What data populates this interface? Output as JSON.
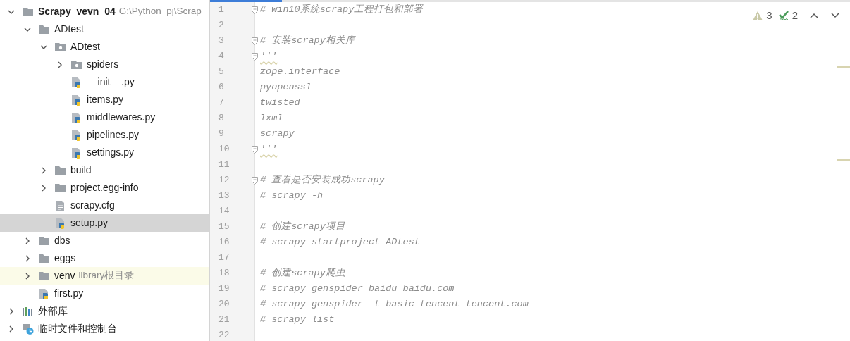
{
  "project_tree": [
    {
      "label": "Scrapy_vevn_04",
      "hint": "G:\\Python_pj\\Scrap",
      "bold": true,
      "kind": "folder",
      "expanded": true,
      "selected": false,
      "highlighted": false,
      "children": [
        {
          "label": "ADtest",
          "kind": "folder",
          "expanded": true,
          "selected": false,
          "highlighted": false,
          "children": [
            {
              "label": "ADtest",
              "kind": "package",
              "expanded": true,
              "selected": false,
              "highlighted": false,
              "children": [
                {
                  "label": "spiders",
                  "kind": "package",
                  "expanded": false,
                  "selected": false,
                  "highlighted": false
                },
                {
                  "label": "__init__.py",
                  "kind": "python",
                  "selected": false,
                  "highlighted": false
                },
                {
                  "label": "items.py",
                  "kind": "python",
                  "selected": false,
                  "highlighted": false
                },
                {
                  "label": "middlewares.py",
                  "kind": "python",
                  "selected": false,
                  "highlighted": false
                },
                {
                  "label": "pipelines.py",
                  "kind": "python",
                  "selected": false,
                  "highlighted": false
                },
                {
                  "label": "settings.py",
                  "kind": "python",
                  "selected": false,
                  "highlighted": false
                }
              ]
            },
            {
              "label": "build",
              "kind": "folder",
              "expanded": false,
              "selected": false,
              "highlighted": false
            },
            {
              "label": "project.egg-info",
              "kind": "folder",
              "expanded": false,
              "selected": false,
              "highlighted": false
            },
            {
              "label": "scrapy.cfg",
              "kind": "text",
              "selected": false,
              "highlighted": false
            },
            {
              "label": "setup.py",
              "kind": "python",
              "selected": true,
              "highlighted": false
            }
          ]
        },
        {
          "label": "dbs",
          "kind": "folder",
          "expanded": false,
          "selected": false,
          "highlighted": false
        },
        {
          "label": "eggs",
          "kind": "folder",
          "expanded": false,
          "selected": false,
          "highlighted": false
        },
        {
          "label": "venv",
          "hint": "library根目录",
          "kind": "folder",
          "expanded": false,
          "selected": false,
          "highlighted": true
        },
        {
          "label": "first.py",
          "kind": "python",
          "selected": false,
          "highlighted": false
        }
      ]
    },
    {
      "label": "外部库",
      "kind": "libraries",
      "expanded": false,
      "selected": false,
      "highlighted": false
    },
    {
      "label": "临时文件和控制台",
      "kind": "scratches",
      "expanded": false,
      "selected": false,
      "highlighted": false
    }
  ],
  "editor": {
    "inspections": [
      {
        "kind": "warning",
        "count": "3"
      },
      {
        "kind": "typo",
        "count": "2"
      }
    ],
    "lines": [
      {
        "number": "1",
        "text": "# win10系统scrapy工程打包和部署",
        "fold": true,
        "warning": false
      },
      {
        "number": "2",
        "fold": false,
        "warning": false
      },
      {
        "number": "3",
        "text": "# 安装scrapy相关库",
        "fold": true,
        "warning": false
      },
      {
        "number": "4",
        "text": "'''",
        "fold": true,
        "warning": true
      },
      {
        "number": "5",
        "text": "zope.interface",
        "fold": false,
        "warning": false
      },
      {
        "number": "6",
        "text": "pyopenssl",
        "fold": false,
        "warning": false
      },
      {
        "number": "7",
        "text": "twisted",
        "fold": false,
        "warning": false
      },
      {
        "number": "8",
        "text": "lxml",
        "fold": false,
        "warning": false
      },
      {
        "number": "9",
        "text": "scrapy",
        "fold": false,
        "warning": false
      },
      {
        "number": "10",
        "text": "'''",
        "fold": true,
        "warning": true
      },
      {
        "number": "11",
        "fold": false,
        "warning": false
      },
      {
        "number": "12",
        "text": "# 查看是否安装成功scrapy",
        "fold": true,
        "warning": false
      },
      {
        "number": "13",
        "text": "# scrapy -h",
        "fold": false,
        "warning": false
      },
      {
        "number": "14",
        "fold": false,
        "warning": false
      },
      {
        "number": "15",
        "text": "# 创建scrapy项目",
        "fold": false,
        "warning": false
      },
      {
        "number": "16",
        "text": "# scrapy startproject ADtest",
        "fold": false,
        "warning": false
      },
      {
        "number": "17",
        "fold": false,
        "warning": false
      },
      {
        "number": "18",
        "text": "# 创建scrapy爬虫",
        "fold": false,
        "warning": false
      },
      {
        "number": "19",
        "text": "# scrapy genspider baidu baidu.com",
        "fold": false,
        "warning": false
      },
      {
        "number": "20",
        "text": "# scrapy genspider -t basic tencent tencent.com",
        "fold": false,
        "warning": false
      },
      {
        "number": "21",
        "text": "# scrapy list",
        "fold": false,
        "warning": false
      },
      {
        "number": "22",
        "fold": false,
        "warning": false
      }
    ]
  }
}
